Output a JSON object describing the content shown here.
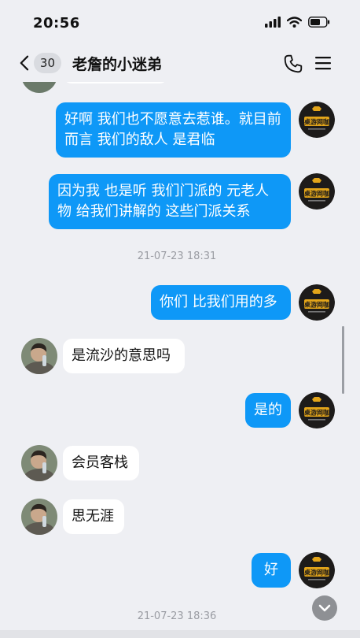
{
  "status_bar": {
    "time": "20:56"
  },
  "header": {
    "back_badge": "30",
    "title": "老詹的小迷弟"
  },
  "messages": [
    {
      "text": "好啊 我们也不愿意去惹谁。就目前而言 我们的敌人 是君临",
      "direction": "out"
    },
    {
      "text": "因为我 也是听 我们门派的 元老人物 给我们讲解的 这些门派关系",
      "direction": "out"
    },
    {
      "text": "你们 比我们用的多",
      "direction": "out"
    },
    {
      "text": "是流沙的意思吗",
      "direction": "in"
    },
    {
      "text": "是的",
      "direction": "out"
    },
    {
      "text": "会员客栈",
      "direction": "in"
    },
    {
      "text": "思无涯",
      "direction": "in"
    },
    {
      "text": "好",
      "direction": "out"
    }
  ],
  "timestamps": [
    "21-07-23 18:31",
    "21-07-23 18:36"
  ],
  "avatars": {
    "self_logo_text": "桌游网咖"
  },
  "icons": {
    "back": "chevron-left-icon",
    "phone": "phone-icon",
    "menu": "hamburger-menu-icon",
    "signal": "signal-icon",
    "wifi": "wifi-icon",
    "battery": "battery-icon",
    "scroll_down": "chevron-down-icon"
  },
  "colors": {
    "outgoing_bubble": "#0e98f7",
    "incoming_bubble": "#ffffff",
    "background": "#eeeff3",
    "timestamp_text": "#9a9ca3"
  }
}
